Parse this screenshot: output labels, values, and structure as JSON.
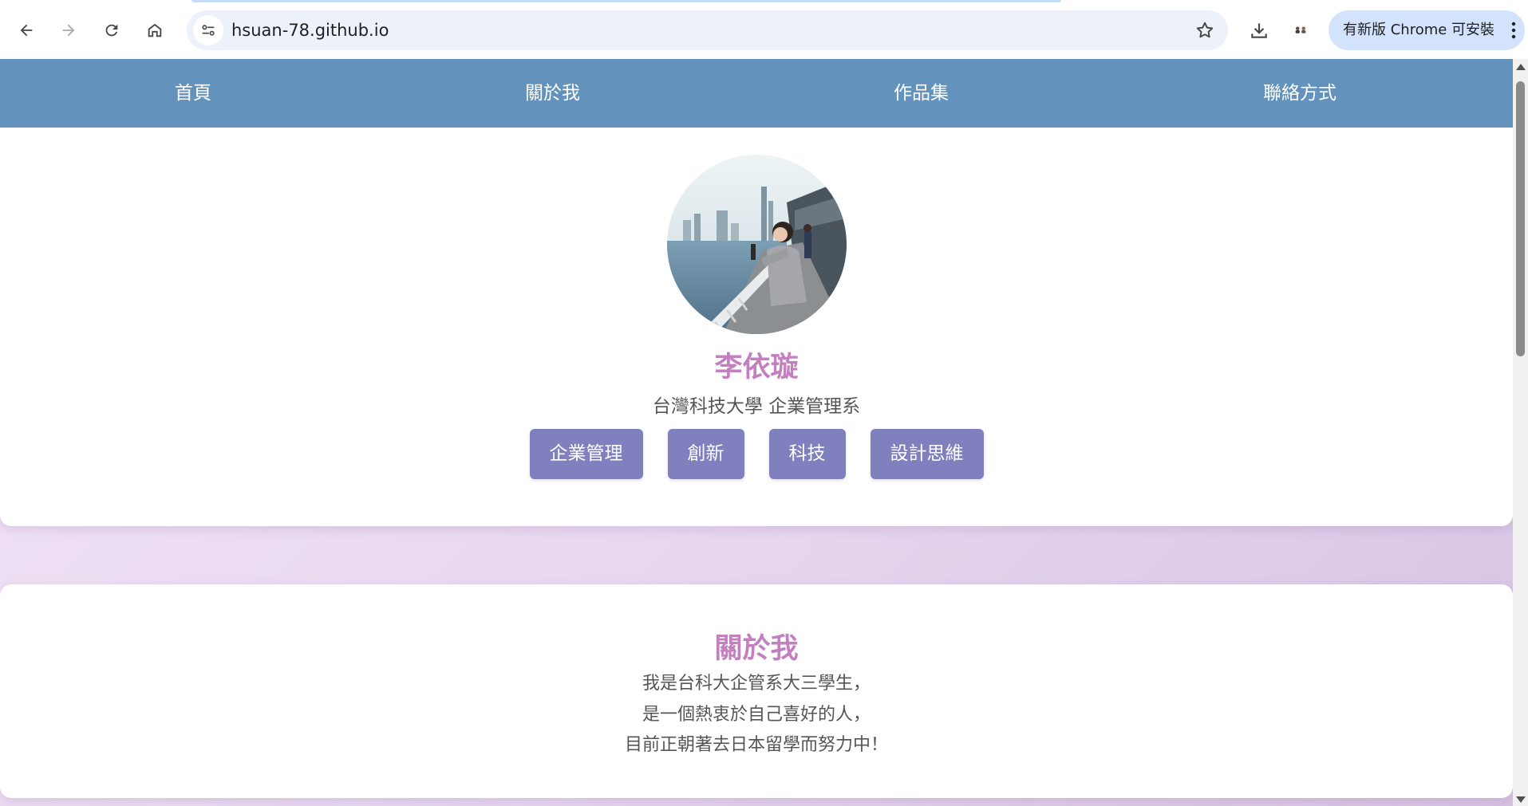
{
  "browser": {
    "url": "hsuan-78.github.io",
    "update_label": "有新版 Chrome 可安裝"
  },
  "nav": {
    "items": [
      {
        "label": "首頁"
      },
      {
        "label": "關於我"
      },
      {
        "label": "作品集"
      },
      {
        "label": "聯絡方式"
      }
    ]
  },
  "profile": {
    "name": "李依璇",
    "school": "台灣科技大學 企業管理系",
    "tags": [
      "企業管理",
      "創新",
      "科技",
      "設計思維"
    ]
  },
  "about": {
    "title": "關於我",
    "lines": [
      "我是台科大企管系大三學生，",
      "是一個熱衷於自己喜好的人，",
      "目前正朝著去日本留學而努力中！"
    ]
  },
  "colors": {
    "nav_bg": "#6393bd",
    "accent": "#c47fc1",
    "tag_bg": "#7f80bd"
  }
}
